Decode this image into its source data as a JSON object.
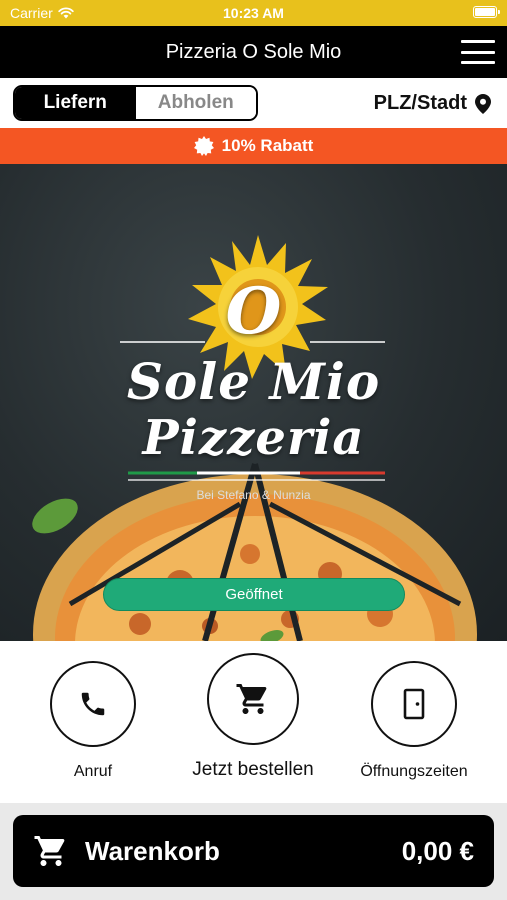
{
  "status_bar": {
    "carrier": "Carrier",
    "time": "10:23 AM"
  },
  "header": {
    "title": "Pizzeria O Sole Mio",
    "menu_icon": "hamburger-menu-icon"
  },
  "delivery": {
    "options": [
      {
        "label": "Liefern",
        "active": true
      },
      {
        "label": "Abholen",
        "active": false
      }
    ],
    "location_label": "PLZ/Stadt",
    "location_icon": "map-pin-icon"
  },
  "promo": {
    "text": "10% Rabatt",
    "icon": "discount-badge-icon",
    "color": "#f45623"
  },
  "hero": {
    "logo_letter": "O",
    "brand_line1": "Sole Mio",
    "brand_line2": "Pizzeria",
    "tagline": "Bei Stefano & Nunzia",
    "status": "Geöffnet",
    "status_color": "#1faa78"
  },
  "actions": [
    {
      "label": "Anruf",
      "icon": "phone-icon"
    },
    {
      "label": "Jetzt bestellen",
      "icon": "shopping-cart-icon"
    },
    {
      "label": "Öffnungszeiten",
      "icon": "door-icon"
    }
  ],
  "cart": {
    "label": "Warenkorb",
    "total": "0,00 €",
    "icon": "shopping-cart-icon"
  },
  "colors": {
    "status_bar": "#e8c11c",
    "header": "#000000",
    "accent": "#f45623"
  }
}
